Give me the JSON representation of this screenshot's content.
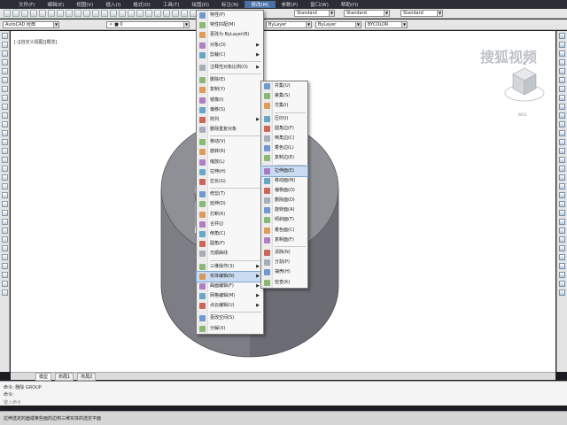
{
  "menubar": {
    "items": [
      {
        "label": "文件(F)"
      },
      {
        "label": "编辑(E)"
      },
      {
        "label": "视图(V)"
      },
      {
        "label": "插入(I)"
      },
      {
        "label": "格式(O)"
      },
      {
        "label": "工具(T)"
      },
      {
        "label": "绘图(D)"
      },
      {
        "label": "标注(N)"
      },
      {
        "label": "修改(M)"
      },
      {
        "label": "参数(P)"
      },
      {
        "label": "窗口(W)"
      },
      {
        "label": "帮助(H)"
      }
    ]
  },
  "toolbar": {
    "workspace": "AutoCAD 经典",
    "style1": "Standard",
    "style2": "Standard",
    "style3": "Standard",
    "style4": "Standard",
    "bylayer1": "ByLayer",
    "bylayer2": "ByLayer",
    "bycolor": "BYCOLOR"
  },
  "canvas": {
    "view_label": "[-][自定义视图][概念]",
    "watermark": "搜狐视频",
    "viewcube_label": "WCS"
  },
  "tabs": [
    "模型",
    "布局1",
    "布局2"
  ],
  "command": {
    "line1": "命令: 删除 GROUP",
    "line2": "命令:",
    "prompt": "键入命令"
  },
  "statusbar": {
    "text": "拉伸选定的面或某些面的边到三维实体的选定平面"
  },
  "modify_menu": {
    "items": [
      {
        "label": "特性(P)",
        "type": "item"
      },
      {
        "label": "特性匹配(M)",
        "type": "item"
      },
      {
        "label": "更改为 ByLayer(B)",
        "type": "item"
      },
      {
        "label": "对象(O)",
        "type": "sub"
      },
      {
        "label": "剪裁(C)",
        "type": "sub"
      },
      {
        "type": "sep"
      },
      {
        "label": "注释性对象比例(O)",
        "type": "sub"
      },
      {
        "type": "sep"
      },
      {
        "label": "删除(E)",
        "type": "item"
      },
      {
        "label": "复制(Y)",
        "type": "item"
      },
      {
        "label": "镜像(I)",
        "type": "item"
      },
      {
        "label": "偏移(S)",
        "type": "item"
      },
      {
        "label": "阵列",
        "type": "sub"
      },
      {
        "label": "删除重复对象",
        "type": "item"
      },
      {
        "type": "sep"
      },
      {
        "label": "移动(V)",
        "type": "item"
      },
      {
        "label": "旋转(R)",
        "type": "item"
      },
      {
        "label": "缩放(L)",
        "type": "item"
      },
      {
        "label": "拉伸(H)",
        "type": "item"
      },
      {
        "label": "拉长(G)",
        "type": "item"
      },
      {
        "type": "sep"
      },
      {
        "label": "修剪(T)",
        "type": "item"
      },
      {
        "label": "延伸(D)",
        "type": "item"
      },
      {
        "label": "打断(K)",
        "type": "item"
      },
      {
        "label": "合并(J)",
        "type": "item"
      },
      {
        "label": "倒角(C)",
        "type": "item"
      },
      {
        "label": "圆角(F)",
        "type": "item"
      },
      {
        "label": "光顺曲线",
        "type": "item"
      },
      {
        "type": "sep"
      },
      {
        "label": "三维操作(3)",
        "type": "sub"
      },
      {
        "label": "实体编辑(N)",
        "type": "sub",
        "highlight": true
      },
      {
        "label": "曲面编辑(F)",
        "type": "sub"
      },
      {
        "label": "网格编辑(M)",
        "type": "sub"
      },
      {
        "label": "点云编辑(U)",
        "type": "sub"
      },
      {
        "type": "sep"
      },
      {
        "label": "更改空间(S)",
        "type": "item"
      },
      {
        "label": "分解(X)",
        "type": "item"
      }
    ]
  },
  "solid_menu": {
    "items": [
      {
        "label": "并集(U)",
        "type": "item"
      },
      {
        "label": "差集(S)",
        "type": "item"
      },
      {
        "label": "交集(I)",
        "type": "item"
      },
      {
        "type": "sep"
      },
      {
        "label": "压印(I)",
        "type": "item"
      },
      {
        "label": "圆角边(F)",
        "type": "item"
      },
      {
        "label": "倒角边(C)",
        "type": "item"
      },
      {
        "label": "着色边(L)",
        "type": "item"
      },
      {
        "label": "复制边(E)",
        "type": "item"
      },
      {
        "type": "sep"
      },
      {
        "label": "拉伸面(E)",
        "type": "item",
        "highlight": true
      },
      {
        "label": "移动面(M)",
        "type": "item"
      },
      {
        "label": "偏移面(O)",
        "type": "item"
      },
      {
        "label": "删除面(D)",
        "type": "item"
      },
      {
        "label": "旋转面(A)",
        "type": "item"
      },
      {
        "label": "倾斜面(T)",
        "type": "item"
      },
      {
        "label": "着色面(C)",
        "type": "item"
      },
      {
        "label": "复制面(F)",
        "type": "item"
      },
      {
        "type": "sep"
      },
      {
        "label": "清除(N)",
        "type": "item"
      },
      {
        "label": "分割(P)",
        "type": "item"
      },
      {
        "label": "抽壳(H)",
        "type": "item"
      },
      {
        "label": "检查(K)",
        "type": "item"
      }
    ]
  },
  "colors": {
    "highlight": "#c9dcf2",
    "solid_top": "#8f9096",
    "solid_side": "#5d5e66",
    "solid_inner": "#a7a8ae"
  }
}
